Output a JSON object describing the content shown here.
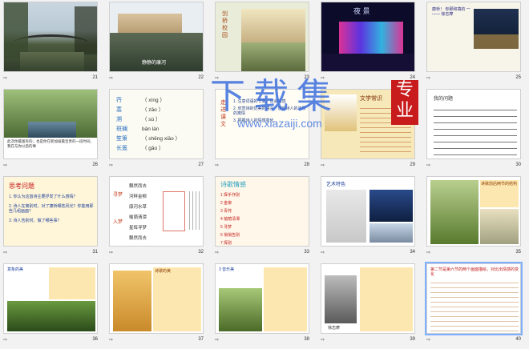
{
  "slides": [
    {
      "num": "21",
      "type": "photo-bridge"
    },
    {
      "num": "22",
      "type": "photo-river",
      "caption": "静静的康河"
    },
    {
      "num": "23",
      "type": "photo-college",
      "vertical": "剑桥校园"
    },
    {
      "num": "24",
      "type": "night",
      "title": "夜 景"
    },
    {
      "num": "25",
      "type": "poem-photo",
      "text": "康桥！ 你那和蔼的 一 —— 徐志摩"
    },
    {
      "num": "26",
      "type": "punting",
      "caption": "此次你最富有的，也是你在新加坡最宝贵的一段时间，我在与你以后的事"
    },
    {
      "num": "27",
      "type": "vocab",
      "words": [
        "荇",
        "蒿",
        "溯",
        "斑斓",
        "笙箫",
        "长篙"
      ],
      "pinyin": [
        "（ xìng ）",
        "（ zāo ）",
        "（ sù ）",
        "bān lán",
        "（ shēng xiāo ）",
        "（ gāo ）"
      ]
    },
    {
      "num": "28",
      "type": "reading",
      "side": "走进课文",
      "items": [
        "1. 注意词语的节奏，体会情感",
        "2. 欣赏诗的优美的语言，感受诗人的浓厚的离情",
        "3. 把握诗人的情感变化"
      ]
    },
    {
      "num": "29",
      "type": "crest",
      "title": "文学常识"
    },
    {
      "num": "30",
      "type": "music",
      "title": "我的问题"
    },
    {
      "num": "31",
      "type": "questions",
      "title": "思考问题",
      "q": [
        "1. 你认为这首诗主要抒发了什么感情？",
        "2. 诗人在离别时，对了康桥哪些风光？你能用那些几组画面？",
        "3. 诗人告别时，做了哪些事？"
      ]
    },
    {
      "num": "32",
      "type": "structure",
      "left": [
        "寻梦",
        "入梦",
        "出梦"
      ],
      "mid": [
        "飘然而去",
        "河畔金柳",
        "康河水草",
        "榆荫清潭",
        "星辉寻梦",
        "飘然而去"
      ]
    },
    {
      "num": "33",
      "type": "poem-flow",
      "title": "诗歌情感",
      "nums": [
        "1 挥手作别",
        "2 金柳",
        "3 青荇",
        "4 榆荫清潭",
        "5 寻梦",
        "6 悄悄告别",
        "7 挥别"
      ]
    },
    {
      "num": "34",
      "type": "slide-photo",
      "title": "艺术特色"
    },
    {
      "num": "35",
      "type": "nature",
      "text": "诗歌前后两节的结构"
    },
    {
      "num": "36",
      "type": "text-photo",
      "text": "意象的美"
    },
    {
      "num": "37",
      "type": "autumn",
      "text": "诗歌的美"
    },
    {
      "num": "38",
      "type": "bridge-photo",
      "text": "3 音乐美"
    },
    {
      "num": "39",
      "type": "portrait",
      "text": "徐志摩"
    },
    {
      "num": "40",
      "type": "text-only",
      "title": "第二节是第六节的两个画面描绘，对比出情感的变化"
    }
  ],
  "watermark": {
    "big": "下载集",
    "url": "www.xiazaiji.com",
    "seal": "专业"
  },
  "colors": {
    "accent": "#c81b1b",
    "selection": "#7fb0ff"
  }
}
